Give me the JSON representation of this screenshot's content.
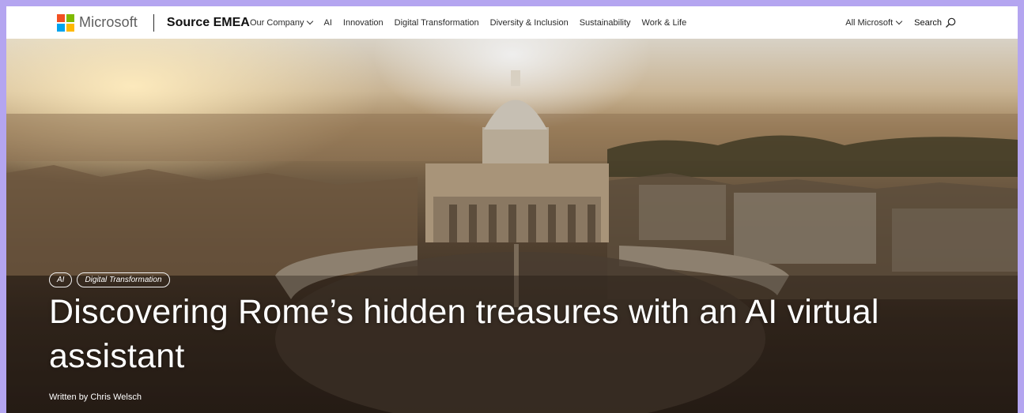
{
  "brand": {
    "logo_name": "Microsoft",
    "site_name": "Source EMEA"
  },
  "nav": {
    "items": [
      {
        "label": "Our Company",
        "dropdown": true
      },
      {
        "label": "AI",
        "dropdown": false
      },
      {
        "label": "Innovation",
        "dropdown": false
      },
      {
        "label": "Digital Transformation",
        "dropdown": false
      },
      {
        "label": "Diversity & Inclusion",
        "dropdown": false
      },
      {
        "label": "Sustainability",
        "dropdown": false
      },
      {
        "label": "Work & Life",
        "dropdown": false
      }
    ],
    "all_microsoft": "All Microsoft",
    "search_label": "Search"
  },
  "hero": {
    "tags": [
      "AI",
      "Digital Transformation"
    ],
    "headline": "Discovering Rome’s hidden treasures with an AI virtual assistant",
    "byline": "Written by Chris Welsch"
  },
  "colors": {
    "frame": "#b4a5f0",
    "logo_red": "#f25022",
    "logo_green": "#7fba00",
    "logo_blue": "#00a4ef",
    "logo_yellow": "#ffb900"
  }
}
